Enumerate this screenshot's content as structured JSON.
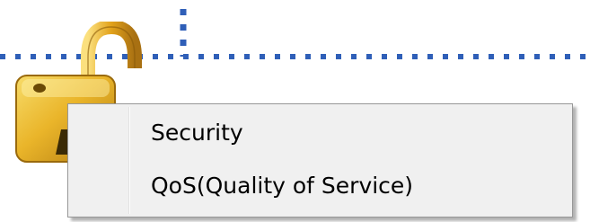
{
  "icons": {
    "lock": "unlocked-padlock-icon"
  },
  "colors": {
    "dotted_line": "#2f5fb8",
    "menu_background": "#f0f0f0",
    "menu_border": "#979797",
    "lock_gold": "#e8b420"
  },
  "context_menu": {
    "items": [
      {
        "label": "Security"
      },
      {
        "label": "QoS(Quality of Service)"
      }
    ]
  }
}
